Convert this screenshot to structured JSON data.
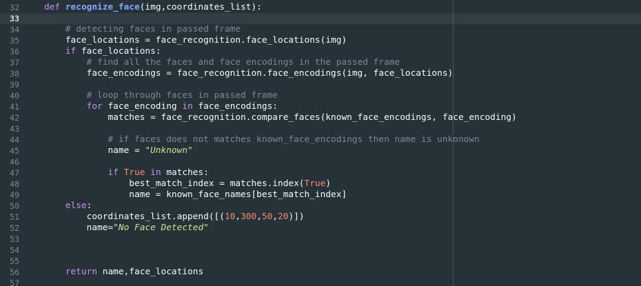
{
  "editor": {
    "colors": {
      "background": "#263238",
      "keyword": "#c792ea",
      "function": "#82aaff",
      "comment": "#778a94",
      "string": "#c3e88d",
      "number": "#f78c6c",
      "line_number": "#7b8a91",
      "active_line": "#323d44"
    },
    "current_line": "33",
    "lines": [
      {
        "n": "32",
        "tokens": [
          {
            "t": "def ",
            "c": "kw"
          },
          {
            "t": "recognize_face",
            "c": "fn"
          },
          {
            "t": "(img,coordinates_list):",
            "c": "plain"
          }
        ]
      },
      {
        "n": "33",
        "tokens": []
      },
      {
        "n": "34",
        "tokens": [
          {
            "t": "    # detecting faces in passed frame",
            "c": "cm"
          }
        ]
      },
      {
        "n": "35",
        "tokens": [
          {
            "t": "    face_locations = face_recognition.face_locations(img)",
            "c": "plain"
          }
        ]
      },
      {
        "n": "36",
        "tokens": [
          {
            "t": "    ",
            "c": "plain"
          },
          {
            "t": "if",
            "c": "kw"
          },
          {
            "t": " face_locations:",
            "c": "plain"
          }
        ]
      },
      {
        "n": "37",
        "tokens": [
          {
            "t": "        # find all the faces and face encodings in the passed frame",
            "c": "cm"
          }
        ]
      },
      {
        "n": "38",
        "tokens": [
          {
            "t": "        face_encodings = face_recognition.face_encodings(img, face_locations)",
            "c": "plain"
          }
        ]
      },
      {
        "n": "39",
        "tokens": []
      },
      {
        "n": "40",
        "tokens": [
          {
            "t": "        # loop through faces in passed frame",
            "c": "cm"
          }
        ]
      },
      {
        "n": "41",
        "tokens": [
          {
            "t": "        ",
            "c": "plain"
          },
          {
            "t": "for",
            "c": "kw"
          },
          {
            "t": " face_encoding ",
            "c": "plain"
          },
          {
            "t": "in",
            "c": "kw"
          },
          {
            "t": " face_encodings:",
            "c": "plain"
          }
        ]
      },
      {
        "n": "42",
        "tokens": [
          {
            "t": "            matches = face_recognition.compare_faces(known_face_encodings, face_encoding)",
            "c": "plain"
          }
        ]
      },
      {
        "n": "43",
        "tokens": []
      },
      {
        "n": "44",
        "tokens": [
          {
            "t": "            # if faces does not matches known_face_encodings then name is unkonown",
            "c": "cm"
          }
        ]
      },
      {
        "n": "45",
        "tokens": [
          {
            "t": "            name = ",
            "c": "plain"
          },
          {
            "t": "\"Unknown\"",
            "c": "str"
          }
        ]
      },
      {
        "n": "46",
        "tokens": []
      },
      {
        "n": "47",
        "tokens": [
          {
            "t": "            ",
            "c": "plain"
          },
          {
            "t": "if",
            "c": "kw"
          },
          {
            "t": " ",
            "c": "plain"
          },
          {
            "t": "True",
            "c": "bool"
          },
          {
            "t": " ",
            "c": "plain"
          },
          {
            "t": "in",
            "c": "kw"
          },
          {
            "t": " matches:",
            "c": "plain"
          }
        ]
      },
      {
        "n": "48",
        "tokens": [
          {
            "t": "                best_match_index = matches.index(",
            "c": "plain"
          },
          {
            "t": "True",
            "c": "bool"
          },
          {
            "t": ")",
            "c": "plain"
          }
        ]
      },
      {
        "n": "49",
        "tokens": [
          {
            "t": "                name = known_face_names[best_match_index]",
            "c": "plain"
          }
        ]
      },
      {
        "n": "50",
        "tokens": [
          {
            "t": "    ",
            "c": "plain"
          },
          {
            "t": "else",
            "c": "kw"
          },
          {
            "t": ":",
            "c": "plain"
          }
        ]
      },
      {
        "n": "51",
        "tokens": [
          {
            "t": "        coordinates_list.append([(",
            "c": "plain"
          },
          {
            "t": "10",
            "c": "num"
          },
          {
            "t": ",",
            "c": "plain"
          },
          {
            "t": "300",
            "c": "num"
          },
          {
            "t": ",",
            "c": "plain"
          },
          {
            "t": "50",
            "c": "num"
          },
          {
            "t": ",",
            "c": "plain"
          },
          {
            "t": "20",
            "c": "num"
          },
          {
            "t": ")])",
            "c": "plain"
          }
        ]
      },
      {
        "n": "52",
        "tokens": [
          {
            "t": "        name=",
            "c": "plain"
          },
          {
            "t": "\"No Face Detected\"",
            "c": "str"
          }
        ]
      },
      {
        "n": "53",
        "tokens": []
      },
      {
        "n": "54",
        "tokens": []
      },
      {
        "n": "55",
        "tokens": []
      },
      {
        "n": "56",
        "tokens": [
          {
            "t": "    ",
            "c": "plain"
          },
          {
            "t": "return",
            "c": "kw"
          },
          {
            "t": " name,face_locations",
            "c": "plain"
          }
        ]
      },
      {
        "n": "57",
        "tokens": []
      }
    ]
  }
}
